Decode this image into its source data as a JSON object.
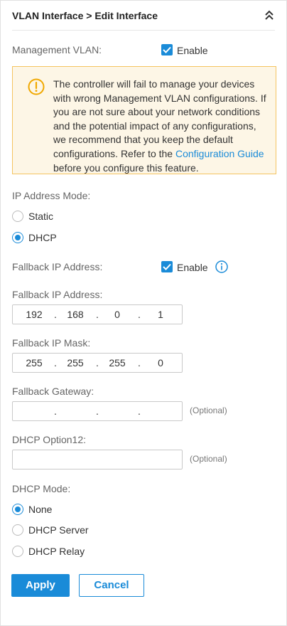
{
  "header": {
    "title": "VLAN Interface > Edit Interface"
  },
  "management_vlan": {
    "label": "Management VLAN:",
    "enable_label": "Enable"
  },
  "warning": {
    "text_before_link": "The controller will fail to manage your devices with wrong Management VLAN configurations. If you are not sure about your network conditions and the potential impact of any configurations, we recommend that you keep the default configurations. Refer to the ",
    "link_text": "Configuration Guide",
    "text_after_link": " before you configure this feature."
  },
  "ip_address_mode": {
    "label": "IP Address Mode:",
    "options": [
      "Static",
      "DHCP"
    ],
    "selected": "DHCP"
  },
  "fallback_enable": {
    "label": "Fallback IP Address:",
    "enable_label": "Enable"
  },
  "fallback_ip": {
    "label": "Fallback IP Address:",
    "octets": [
      "192",
      "168",
      "0",
      "1"
    ]
  },
  "fallback_mask": {
    "label": "Fallback IP Mask:",
    "octets": [
      "255",
      "255",
      "255",
      "0"
    ]
  },
  "fallback_gateway": {
    "label": "Fallback Gateway:",
    "octets": [
      "",
      "",
      "",
      ""
    ],
    "hint": "(Optional)"
  },
  "dhcp_option12": {
    "label": "DHCP Option12:",
    "value": "",
    "hint": "(Optional)"
  },
  "dhcp_mode": {
    "label": "DHCP Mode:",
    "options": [
      "None",
      "DHCP Server",
      "DHCP Relay"
    ],
    "selected": "None"
  },
  "actions": {
    "apply_label": "Apply",
    "cancel_label": "Cancel"
  },
  "colors": {
    "accent": "#1a8bd8",
    "warning_bg": "#fdf6e6",
    "warning_border": "#f4c460",
    "warning_icon": "#f0a800"
  },
  "icons": {
    "collapse": "double-chevron-up-icon",
    "warning": "warning-circle-icon",
    "info": "info-circle-icon",
    "checkbox": "check-icon"
  }
}
